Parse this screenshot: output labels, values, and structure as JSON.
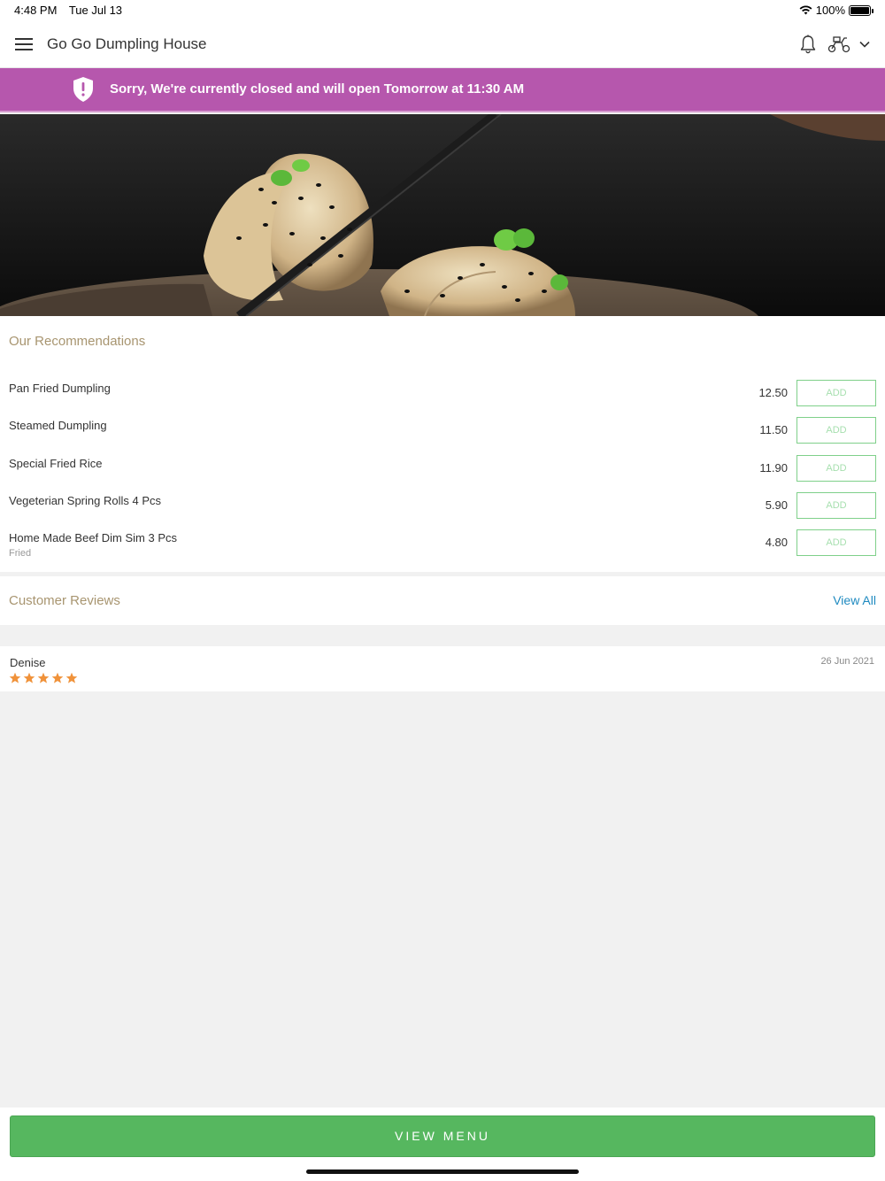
{
  "status_bar": {
    "time": "4:48 PM",
    "date": "Tue Jul 13",
    "battery": "100%"
  },
  "header": {
    "title": "Go Go Dumpling House"
  },
  "banner": {
    "message": "Sorry, We're currently closed and will open Tomorrow at 11:30 AM",
    "color": "#b657ad"
  },
  "recommendations": {
    "title": "Our Recommendations",
    "add_label": "ADD",
    "items": [
      {
        "name": "Pan Fried Dumpling",
        "price": "12.50",
        "note": ""
      },
      {
        "name": "Steamed Dumpling",
        "price": "11.50",
        "note": ""
      },
      {
        "name": "Special Fried Rice",
        "price": "11.90",
        "note": ""
      },
      {
        "name": "Vegeterian Spring Rolls 4 Pcs",
        "price": "5.90",
        "note": ""
      },
      {
        "name": "Home Made Beef Dim Sim 3 Pcs",
        "price": "4.80",
        "note": "Fried"
      }
    ]
  },
  "reviews": {
    "title": "Customer Reviews",
    "view_all_label": "View All",
    "items": [
      {
        "reviewer": "Denise",
        "date": "26 Jun 2021",
        "rating": 5
      }
    ]
  },
  "footer": {
    "view_menu_label": "VIEW MENU",
    "accent": "#56b75f"
  }
}
